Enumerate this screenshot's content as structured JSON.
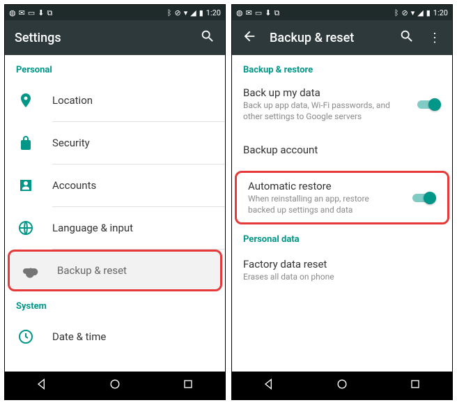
{
  "status": {
    "time": "1:20"
  },
  "left": {
    "title": "Settings",
    "section_personal": "Personal",
    "items": {
      "location": "Location",
      "security": "Security",
      "accounts": "Accounts",
      "language": "Language & input",
      "backup": "Backup & reset"
    },
    "section_system": "System",
    "items_system": {
      "datetime": "Date & time"
    }
  },
  "right": {
    "title": "Backup & reset",
    "section_backup": "Backup & restore",
    "items": {
      "backup_data": {
        "title": "Back up my data",
        "sub": "Back up app data, Wi-Fi passwords, and other settings to Google servers"
      },
      "backup_account": {
        "title": "Backup account"
      },
      "auto_restore": {
        "title": "Automatic restore",
        "sub": "When reinstalling an app, restore backed up settings and data"
      }
    },
    "section_personal": "Personal data",
    "items2": {
      "factory": {
        "title": "Factory data reset",
        "sub": "Erases all data on phone"
      }
    }
  }
}
